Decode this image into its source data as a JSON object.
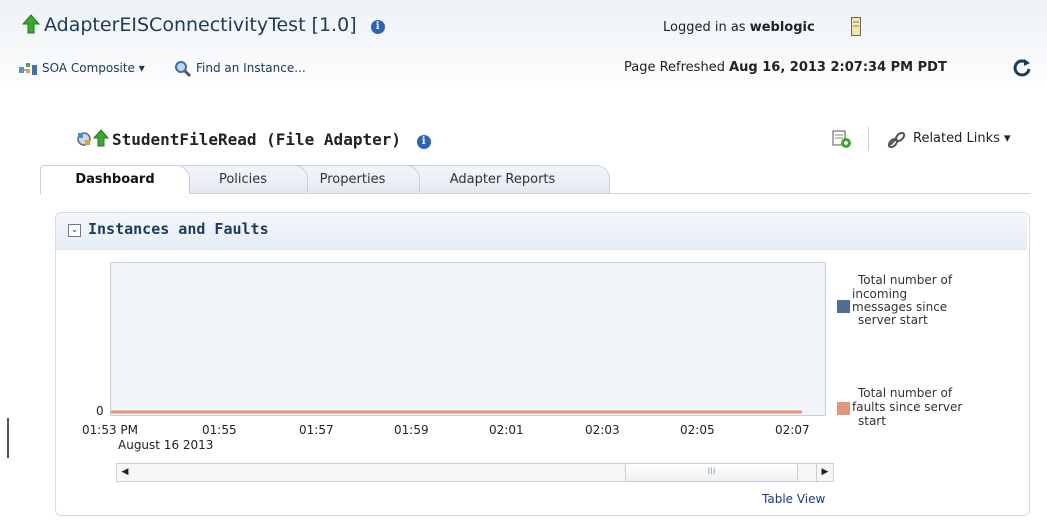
{
  "header": {
    "app_title": "AdapterEISConnectivityTest [1.0]",
    "composite_menu": "SOA Composite",
    "find_instance": "Find an Instance...",
    "logged_in_prefix": "Logged in as",
    "user": "weblogic",
    "refreshed_prefix": "Page Refreshed",
    "refreshed_time": "Aug 16, 2013 2:07:34 PM PDT"
  },
  "component": {
    "title": "StudentFileRead (File Adapter)",
    "related_links": "Related Links"
  },
  "tabs": [
    {
      "label": "Dashboard",
      "active": true
    },
    {
      "label": "Policies",
      "active": false
    },
    {
      "label": "Properties",
      "active": false
    },
    {
      "label": "Adapter Reports",
      "active": false
    }
  ],
  "panel": {
    "title": "Instances and Faults",
    "table_view": "Table View"
  },
  "chart_data": {
    "type": "line",
    "y_tick": "0",
    "x_ticks": [
      "01:53 PM",
      "01:55",
      "01:57",
      "01:59",
      "02:01",
      "02:03",
      "02:05",
      "02:07"
    ],
    "x_subtitle": "August 16 2013",
    "series": [
      {
        "name": "Total number of incoming messages since server start",
        "color": "#4f6f90",
        "values": [
          0,
          0,
          0,
          0,
          0,
          0,
          0,
          0
        ]
      },
      {
        "name": "Total number of faults since server start",
        "color": "#e0977a",
        "values": [
          0,
          0,
          0,
          0,
          0,
          0,
          0,
          0
        ]
      }
    ],
    "legend_lines": [
      [
        "Total number of",
        "incoming",
        "messages since",
        "server start"
      ],
      [
        "Total number of",
        "faults since server",
        "start"
      ]
    ]
  },
  "colors": {
    "header_text": "#1b3a5c",
    "link": "#1b3a8c",
    "up_arrow": "#3aa832",
    "incoming": "#4f6f90",
    "faults": "#e0977a"
  }
}
